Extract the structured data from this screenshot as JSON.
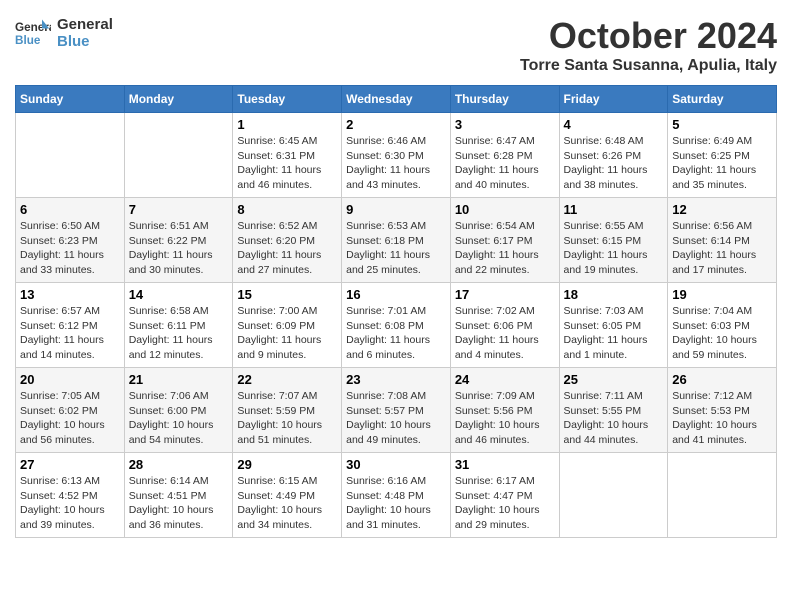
{
  "header": {
    "logo_line1": "General",
    "logo_line2": "Blue",
    "month": "October 2024",
    "location": "Torre Santa Susanna, Apulia, Italy"
  },
  "weekdays": [
    "Sunday",
    "Monday",
    "Tuesday",
    "Wednesday",
    "Thursday",
    "Friday",
    "Saturday"
  ],
  "weeks": [
    [
      {
        "day": "",
        "info": ""
      },
      {
        "day": "",
        "info": ""
      },
      {
        "day": "1",
        "info": "Sunrise: 6:45 AM\nSunset: 6:31 PM\nDaylight: 11 hours and 46 minutes."
      },
      {
        "day": "2",
        "info": "Sunrise: 6:46 AM\nSunset: 6:30 PM\nDaylight: 11 hours and 43 minutes."
      },
      {
        "day": "3",
        "info": "Sunrise: 6:47 AM\nSunset: 6:28 PM\nDaylight: 11 hours and 40 minutes."
      },
      {
        "day": "4",
        "info": "Sunrise: 6:48 AM\nSunset: 6:26 PM\nDaylight: 11 hours and 38 minutes."
      },
      {
        "day": "5",
        "info": "Sunrise: 6:49 AM\nSunset: 6:25 PM\nDaylight: 11 hours and 35 minutes."
      }
    ],
    [
      {
        "day": "6",
        "info": "Sunrise: 6:50 AM\nSunset: 6:23 PM\nDaylight: 11 hours and 33 minutes."
      },
      {
        "day": "7",
        "info": "Sunrise: 6:51 AM\nSunset: 6:22 PM\nDaylight: 11 hours and 30 minutes."
      },
      {
        "day": "8",
        "info": "Sunrise: 6:52 AM\nSunset: 6:20 PM\nDaylight: 11 hours and 27 minutes."
      },
      {
        "day": "9",
        "info": "Sunrise: 6:53 AM\nSunset: 6:18 PM\nDaylight: 11 hours and 25 minutes."
      },
      {
        "day": "10",
        "info": "Sunrise: 6:54 AM\nSunset: 6:17 PM\nDaylight: 11 hours and 22 minutes."
      },
      {
        "day": "11",
        "info": "Sunrise: 6:55 AM\nSunset: 6:15 PM\nDaylight: 11 hours and 19 minutes."
      },
      {
        "day": "12",
        "info": "Sunrise: 6:56 AM\nSunset: 6:14 PM\nDaylight: 11 hours and 17 minutes."
      }
    ],
    [
      {
        "day": "13",
        "info": "Sunrise: 6:57 AM\nSunset: 6:12 PM\nDaylight: 11 hours and 14 minutes."
      },
      {
        "day": "14",
        "info": "Sunrise: 6:58 AM\nSunset: 6:11 PM\nDaylight: 11 hours and 12 minutes."
      },
      {
        "day": "15",
        "info": "Sunrise: 7:00 AM\nSunset: 6:09 PM\nDaylight: 11 hours and 9 minutes."
      },
      {
        "day": "16",
        "info": "Sunrise: 7:01 AM\nSunset: 6:08 PM\nDaylight: 11 hours and 6 minutes."
      },
      {
        "day": "17",
        "info": "Sunrise: 7:02 AM\nSunset: 6:06 PM\nDaylight: 11 hours and 4 minutes."
      },
      {
        "day": "18",
        "info": "Sunrise: 7:03 AM\nSunset: 6:05 PM\nDaylight: 11 hours and 1 minute."
      },
      {
        "day": "19",
        "info": "Sunrise: 7:04 AM\nSunset: 6:03 PM\nDaylight: 10 hours and 59 minutes."
      }
    ],
    [
      {
        "day": "20",
        "info": "Sunrise: 7:05 AM\nSunset: 6:02 PM\nDaylight: 10 hours and 56 minutes."
      },
      {
        "day": "21",
        "info": "Sunrise: 7:06 AM\nSunset: 6:00 PM\nDaylight: 10 hours and 54 minutes."
      },
      {
        "day": "22",
        "info": "Sunrise: 7:07 AM\nSunset: 5:59 PM\nDaylight: 10 hours and 51 minutes."
      },
      {
        "day": "23",
        "info": "Sunrise: 7:08 AM\nSunset: 5:57 PM\nDaylight: 10 hours and 49 minutes."
      },
      {
        "day": "24",
        "info": "Sunrise: 7:09 AM\nSunset: 5:56 PM\nDaylight: 10 hours and 46 minutes."
      },
      {
        "day": "25",
        "info": "Sunrise: 7:11 AM\nSunset: 5:55 PM\nDaylight: 10 hours and 44 minutes."
      },
      {
        "day": "26",
        "info": "Sunrise: 7:12 AM\nSunset: 5:53 PM\nDaylight: 10 hours and 41 minutes."
      }
    ],
    [
      {
        "day": "27",
        "info": "Sunrise: 6:13 AM\nSunset: 4:52 PM\nDaylight: 10 hours and 39 minutes."
      },
      {
        "day": "28",
        "info": "Sunrise: 6:14 AM\nSunset: 4:51 PM\nDaylight: 10 hours and 36 minutes."
      },
      {
        "day": "29",
        "info": "Sunrise: 6:15 AM\nSunset: 4:49 PM\nDaylight: 10 hours and 34 minutes."
      },
      {
        "day": "30",
        "info": "Sunrise: 6:16 AM\nSunset: 4:48 PM\nDaylight: 10 hours and 31 minutes."
      },
      {
        "day": "31",
        "info": "Sunrise: 6:17 AM\nSunset: 4:47 PM\nDaylight: 10 hours and 29 minutes."
      },
      {
        "day": "",
        "info": ""
      },
      {
        "day": "",
        "info": ""
      }
    ]
  ]
}
